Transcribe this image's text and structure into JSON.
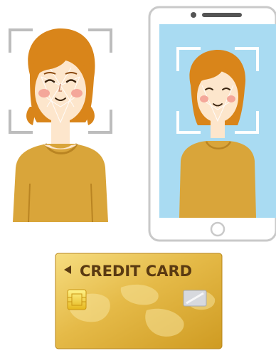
{
  "credit_card": {
    "label": "CREDIT CARD",
    "colors": {
      "gold_light": "#f2d36a",
      "gold_mid": "#e2b43f",
      "gold_dark": "#c8941c",
      "text": "#5a3a12"
    }
  },
  "icons": [
    "face-scan-woman-icon",
    "phone-face-scan-icon",
    "credit-card-icon"
  ],
  "colors": {
    "hair": "#d9851a",
    "hair_dark": "#b8680f",
    "skin": "#fde6cc",
    "cheek": "#f4a79a",
    "sweater": "#d9a53a",
    "sweater_dark": "#b98422",
    "scan_frame": "#bdbdbd",
    "phone_screen": "#a9dbf2",
    "phone_body": "#ffffff",
    "phone_border": "#c9c9c9"
  }
}
